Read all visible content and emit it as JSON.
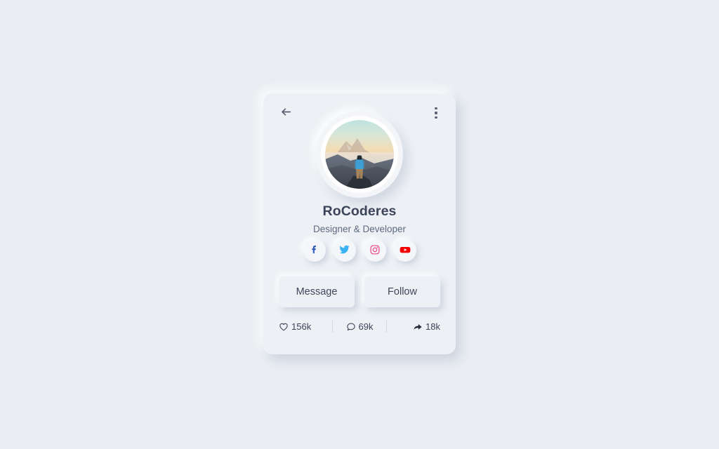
{
  "page": {
    "background_color": "#eaeef2"
  },
  "card": {
    "background_color": "#edf0f4",
    "topbar": {
      "back_icon": "arrow-left-icon",
      "back_label": "Back",
      "menu_icon": "more-vertical-icon",
      "menu_label": "More options"
    },
    "avatar": {
      "icon": "avatar-photo",
      "alt": "Person in blue shirt standing on rock overlooking sunset mountains",
      "sky_top_color": "#b9dfe0",
      "sky_mid_color": "#f6d7a8",
      "sky_horizon_color": "#f3c98f",
      "mountain_color": "#c9b6a8",
      "ridge_color": "#4e5560",
      "shirt_color": "#3e9fd4",
      "pants_color": "#a5845a"
    },
    "identity": {
      "name": "RoCoderes",
      "role": "Designer & Developer",
      "name_color": "#3c4459",
      "role_color": "#5f6980"
    },
    "socials": [
      {
        "name": "facebook",
        "icon": "facebook-icon",
        "label": "Facebook",
        "color": "#2f58b8"
      },
      {
        "name": "twitter",
        "icon": "twitter-icon",
        "label": "Twitter",
        "color": "#3ab3f2"
      },
      {
        "name": "instagram",
        "icon": "instagram-icon",
        "label": "Instagram",
        "color": "#f0538a"
      },
      {
        "name": "youtube",
        "icon": "youtube-icon",
        "label": "YouTube",
        "color": "#f50000"
      }
    ],
    "actions": {
      "message_label": "Message",
      "follow_label": "Follow"
    },
    "stats": [
      {
        "name": "likes",
        "icon": "heart-icon",
        "value": "156k"
      },
      {
        "name": "comments",
        "icon": "comment-icon",
        "value": "69k"
      },
      {
        "name": "shares",
        "icon": "share-icon",
        "value": "18k"
      }
    ]
  }
}
